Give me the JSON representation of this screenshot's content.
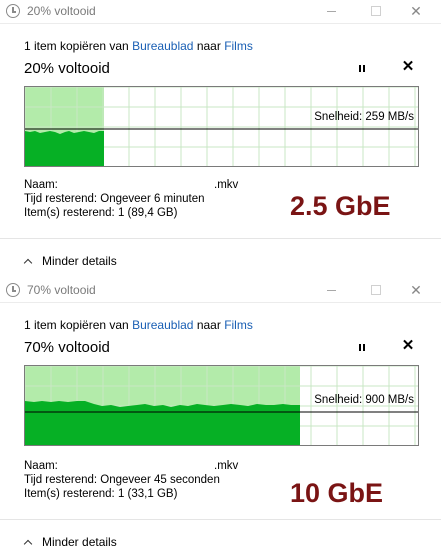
{
  "dialogs": [
    {
      "title": "20% voltooid",
      "copy_line": {
        "prefix": "1 item kopiëren van",
        "source": "Bureaublad",
        "middle": "naar",
        "dest": "Films"
      },
      "progress_text": "20% voltooid",
      "progress_fraction": 0.2,
      "speed_label": "Snelheid: 259 MB/s",
      "info": {
        "name_label": "Naam:",
        "name_value": ".mkv",
        "time_label": "Tijd resterend:",
        "time_value": "Ongeveer 6 minuten",
        "items_label": "Item(s) resterend:",
        "items_value": "1 (89,4 GB)"
      },
      "overlay": "2.5 GbE",
      "details_label": "Minder details"
    },
    {
      "title": "70% voltooid",
      "copy_line": {
        "prefix": "1 item kopiëren van",
        "source": "Bureaublad",
        "middle": "naar",
        "dest": "Films"
      },
      "progress_text": "70% voltooid",
      "progress_fraction": 0.7,
      "speed_label": "Snelheid: 900 MB/s",
      "info": {
        "name_label": "Naam:",
        "name_value": ".mkv",
        "time_label": "Tijd resterend:",
        "time_value": "Ongeveer 45 seconden",
        "items_label": "Item(s) resterend:",
        "items_value": "1 (33,1 GB)"
      },
      "overlay": "10 GbE",
      "details_label": "Minder details"
    }
  ],
  "colors": {
    "progress_light": "#b3ebaa",
    "speed_fill": "#06b025",
    "grid": "#c9e7c4",
    "overlay_text": "#7a1414",
    "link": "#1a5fb4"
  }
}
